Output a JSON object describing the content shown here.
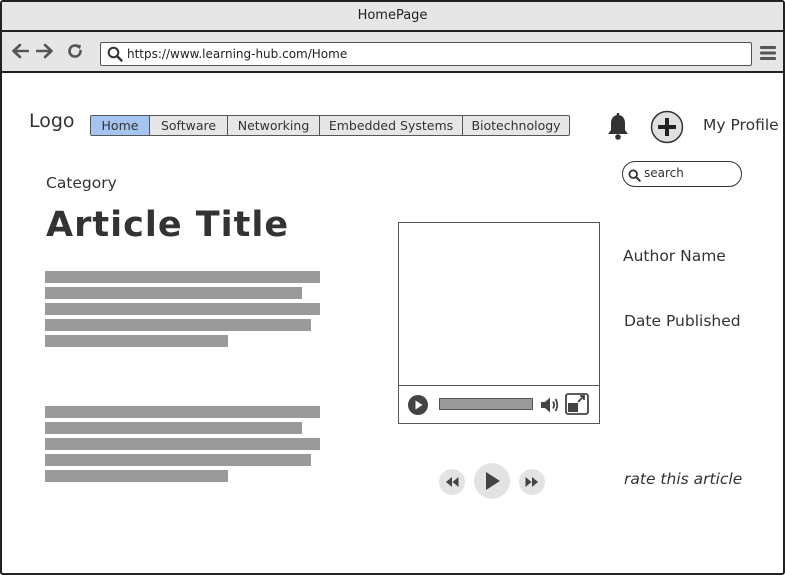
{
  "window": {
    "title": "HomePage"
  },
  "browser": {
    "url": "https://www.learning-hub.com/Home",
    "icons": {
      "back": "arrow-left-icon",
      "forward": "arrow-right-icon",
      "reload": "reload-icon",
      "menu": "hamburger-menu-icon"
    }
  },
  "header": {
    "logo": "Logo",
    "tabs": [
      {
        "label": "Home",
        "active": true
      },
      {
        "label": "Software",
        "active": false
      },
      {
        "label": "Networking",
        "active": false
      },
      {
        "label": "Embedded Systems",
        "active": false
      },
      {
        "label": "Biotechnology",
        "active": false
      }
    ],
    "profile_label": "My Profile",
    "icons": {
      "notifications": "bell-icon",
      "add": "plus-circle-icon"
    }
  },
  "search": {
    "placeholder": "search"
  },
  "article": {
    "category": "Category",
    "title": "Article Title",
    "author": "Author Name",
    "date": "Date Published",
    "rate_label": "rate this article"
  },
  "media": {
    "player_icons": [
      "play-icon",
      "volume-icon",
      "fullscreen-icon"
    ],
    "controls": [
      "rewind-icon",
      "play-icon",
      "fast-forward-icon"
    ]
  },
  "colors": {
    "active_tab": "#a6c4f0",
    "chrome": "#e6e6e6",
    "placeholder_text": "#9a9a9a",
    "border": "#222222"
  }
}
